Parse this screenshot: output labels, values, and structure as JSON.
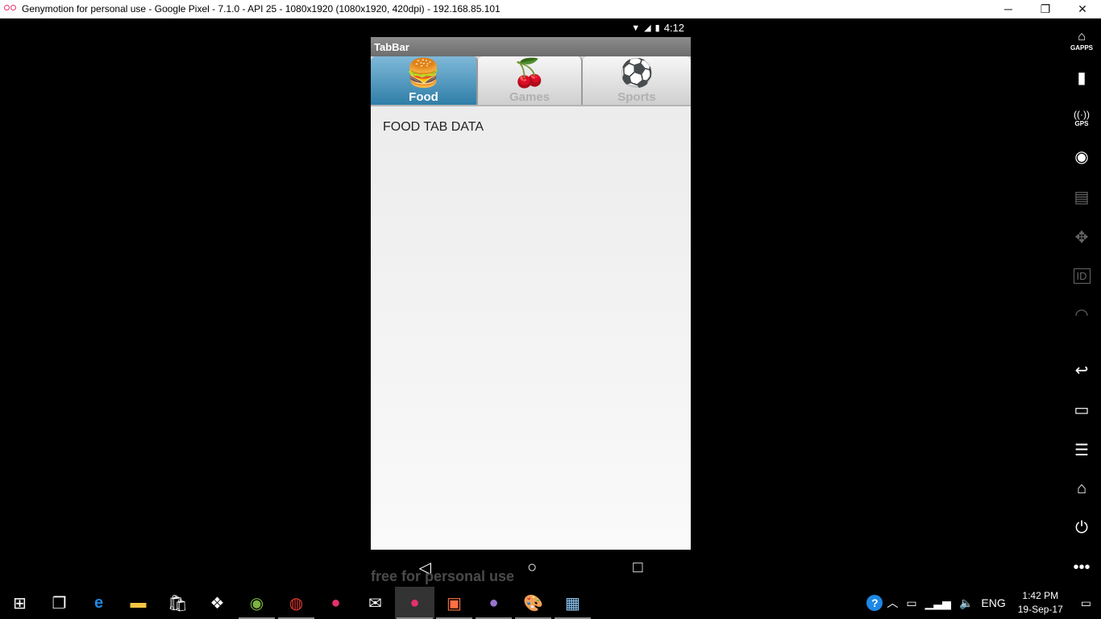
{
  "window": {
    "title": "Genymotion for personal use - Google Pixel - 7.1.0 - API 25 - 1080x1920 (1080x1920, 420dpi) - 192.168.85.101",
    "minimize": "─",
    "restore": "❐",
    "close": "✕"
  },
  "status_bar": {
    "wifi": "▼",
    "signal": "◢",
    "battery": "▮",
    "time": "4:12"
  },
  "app": {
    "title": "TabBar",
    "tabs": [
      {
        "label": "Food",
        "icon": "food-icon",
        "glyph": "🍔",
        "active": true
      },
      {
        "label": "Games",
        "icon": "cherries-icon",
        "glyph": "🍒",
        "active": false
      },
      {
        "label": "Sports",
        "icon": "soccer-ball-icon",
        "glyph": "⚽",
        "active": false
      }
    ],
    "content_text": "FOOD TAB DATA"
  },
  "nav_bar": {
    "back": "◁",
    "home": "○",
    "recents": "□"
  },
  "watermark": "free for personal use",
  "sidebar": {
    "gapps_label": "GAPPS",
    "gps_label": "GPS",
    "id_label": "ID"
  },
  "taskbar": {
    "icons": [
      "windows-start-icon",
      "task-view-icon",
      "edge-icon",
      "file-explorer-icon",
      "store-icon",
      "dropbox-icon",
      "android-studio-icon",
      "chrome-icon",
      "genymotion-icon",
      "mail-icon",
      "genymotion-window-icon",
      "pdf-icon",
      "github-icon",
      "paint-icon",
      "image-viewer-icon"
    ],
    "tray": {
      "help": "?",
      "language": "ENG",
      "time": "1:42 PM",
      "date": "19-Sep-17"
    }
  },
  "colors": {
    "active_tab": "#2f7ea8",
    "action_bar": "#7a7a7a",
    "genymotion_brand": "#e5306a"
  }
}
